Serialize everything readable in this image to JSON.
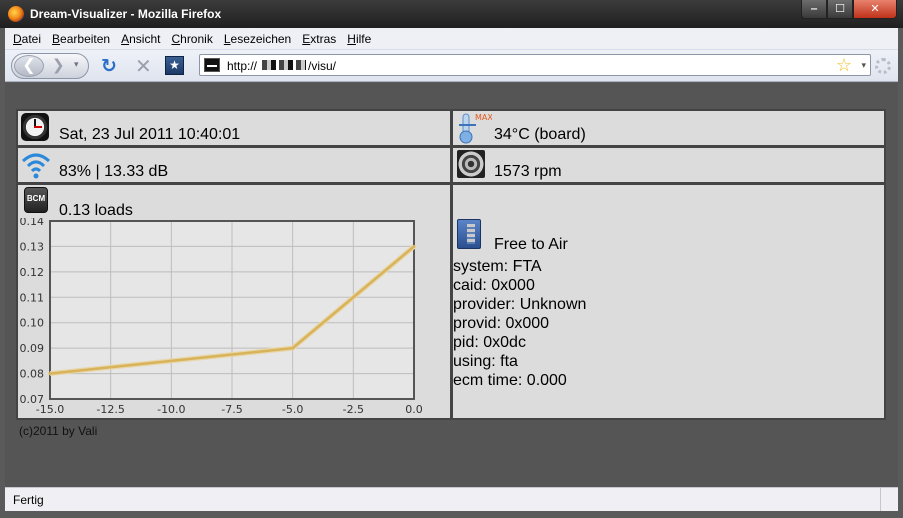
{
  "window": {
    "title": "Dream-Visualizer - Mozilla Firefox",
    "minimize_glyph": "‒",
    "maximize_glyph": "☐",
    "close_glyph": "✕"
  },
  "menu": [
    "Datei",
    "Bearbeiten",
    "Ansicht",
    "Chronik",
    "Lesezeichen",
    "Extras",
    "Hilfe"
  ],
  "navbar": {
    "back_glyph": "❮",
    "forward_glyph": "❯",
    "dropdown_glyph": "▾",
    "reload_glyph": "↻",
    "stop_glyph": "✕",
    "bookmark_glyph": "★",
    "url_prefix": "http://",
    "url_path": "/visu/",
    "star_glyph": "☆",
    "url_dropdown_glyph": "▾"
  },
  "panels": {
    "datetime": "Sat, 23 Jul 2011 10:40:01",
    "temperature": "34°C (board)",
    "temperature_badge": "MAX",
    "wifi": "83% | 13.33 dB",
    "fan": "1573 rpm",
    "load": "0.13 loads",
    "bcm_label": "BCM",
    "channel": {
      "name": "Free to Air",
      "lines": [
        "system: FTA",
        "caid: 0x000",
        "provider: Unknown",
        "provid: 0x000",
        "pid: 0x0dc",
        "using: fta",
        "ecm time: 0.000"
      ]
    }
  },
  "footer": "(c)2011 by Vali",
  "status": "Fertig",
  "colors": {
    "line": "#d8b35a",
    "panel_bg": "#dcdcdc",
    "page_bg": "#555555"
  },
  "chart_data": {
    "type": "line",
    "x": [
      -15.0,
      -5.0,
      0.0
    ],
    "series": [
      {
        "values": [
          0.08,
          0.09,
          0.13
        ]
      }
    ],
    "xlim": [
      -15.0,
      0.0
    ],
    "ylim": [
      0.07,
      0.14
    ],
    "xticks": [
      "-15.0",
      "-12.5",
      "-10.0",
      "-7.5",
      "-5.0",
      "-2.5",
      "0.0"
    ],
    "yticks": [
      "0.07",
      "0.08",
      "0.09",
      "0.10",
      "0.11",
      "0.12",
      "0.13",
      "0.14"
    ],
    "grid": true
  }
}
